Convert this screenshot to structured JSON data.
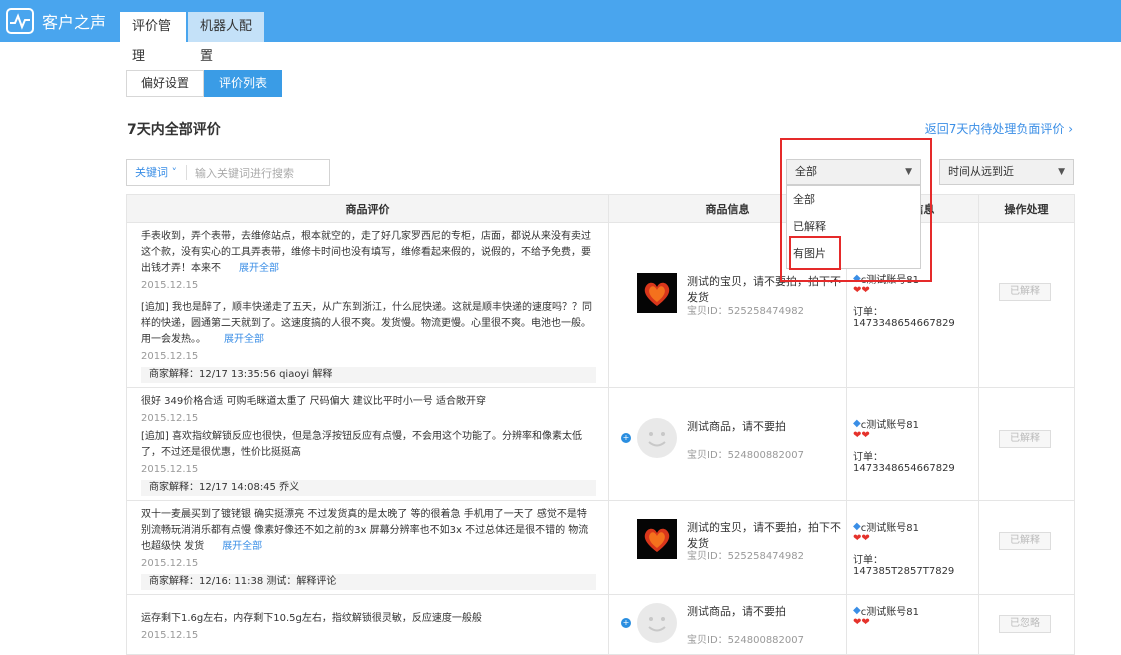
{
  "header": {
    "app_name": "客户之声",
    "tabs": [
      "评价管理",
      "机器人配置"
    ]
  },
  "subtabs": [
    "偏好设置",
    "评价列表"
  ],
  "section_title": "7天内全部评价",
  "back_link": "返回7天内待处理负面评价",
  "search": {
    "keyword_label": "关键词",
    "placeholder": "输入关键词进行搜索"
  },
  "filter": {
    "selected": "全部",
    "options": [
      "全部",
      "已解释",
      "有图片"
    ]
  },
  "sort": {
    "selected": "时间从远到近"
  },
  "table": {
    "headers": [
      "商品评价",
      "商品信息",
      "买家信息",
      "操作处理"
    ],
    "rows": [
      {
        "review": "手表收到，弄个表带，去维修站点，根本就空的，走了好几家罗西尼的专柜，店面，都说从来没有卖过这个款，没有实心的工具弄表带，维修卡时间也没有填写，维修看起来假的，说假的，不给予免费，要出钱才弄！本来不",
        "expand": "展开全部",
        "date": "2015.12.15",
        "append": "[追加] 我也是醉了，顺丰快递走了五天，从广东到浙江，什么屁快递。这就是顺丰快递的速度吗？？同样的快递，圆通第二天就到了。这速度搞的人很不爽。发货慢。物流更慢。心里很不爽。电池也一般。用一会发热。。",
        "append_expand": "展开全部",
        "append_date": "2015.12.15",
        "reply": "商家解释：12/17 13:35:56 qiaoyi 解释",
        "product_name": "测试的宝贝，请不要拍，拍下不发货",
        "product_id": "宝贝ID：525258474982",
        "buyer_name": "c测试账号81",
        "order": "订单：1473348654667829",
        "action": "已解释"
      },
      {
        "review": "很好 349价格合适 可购毛眯道太重了 尺码偏大 建议比平时小一号 适合敞开穿",
        "date": "2015.12.15",
        "append": "[追加] 喜欢指纹解锁反应也很快，但是急浮按钮反应有点慢，不会用这个功能了。分辨率和像素太低了，不过还是很优惠，性价比挺挺高",
        "append_date": "2015.12.15",
        "reply": "商家解释：12/17 14:08:45 乔义",
        "product_name": "测试商品，请不要拍",
        "product_id": "宝贝ID：524800882007",
        "buyer_name": "c测试账号81",
        "order": "订单：1473348654667829",
        "action": "已解释"
      },
      {
        "review": "双十一麦晨买到了镀铑银 确实挺漂亮 不过发货真的是太晚了 等的很着急 手机用了一天了 感觉不是特别流畅玩消消乐都有点慢 像素好像还不如之前的3x 屏幕分辨率也不如3x 不过总体还是很不错的 物流也超级快 发货",
        "expand": "展开全部",
        "date": "2015.12.15",
        "reply": "商家解释：12/16: 11:38 测试：解释评论",
        "product_name": "测试的宝贝，请不要拍，拍下不发货",
        "product_id": "宝贝ID：525258474982",
        "buyer_name": "c测试账号81",
        "order": "订单：147385T2857T7829",
        "action": "已解释"
      },
      {
        "review": "运存剩下1.6g左右，内存剩下10.5g左右，指纹解锁很灵敏，反应速度一般般",
        "date": "2015.12.15",
        "product_name": "测试商品，请不要拍",
        "product_id": "宝贝ID：524800882007",
        "buyer_name": "c测试账号81",
        "action": "已忽略"
      }
    ]
  }
}
